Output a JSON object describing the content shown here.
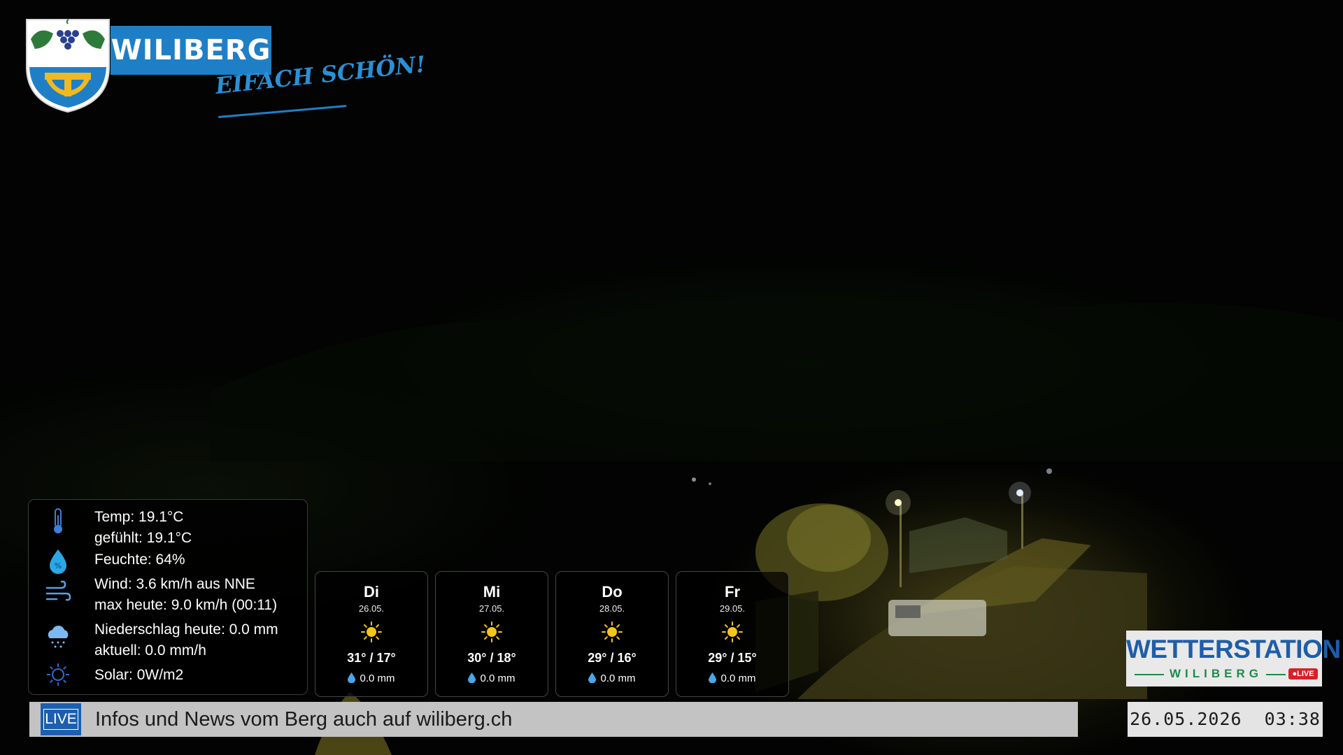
{
  "branding": {
    "name": "WILIBERG",
    "slogan": "EIFACH SCHÖN!",
    "brand_color": "#1f7fc6"
  },
  "current": {
    "temp": "Temp: 19.1°C",
    "feels": "gefühlt: 19.1°C",
    "humidity": "Feuchte: 64%",
    "wind": "Wind: 3.6 km/h aus NNE",
    "wind_max": "max heute: 9.0 km/h (00:11)",
    "precip_today": "Niederschlag heute: 0.0 mm",
    "precip_now": "aktuell: 0.0 mm/h",
    "solar": "Solar: 0W/m2",
    "icons": [
      "thermometer-icon",
      "humidity-drop-icon",
      "wind-icon",
      "rain-cloud-icon",
      "sun-outline-icon"
    ]
  },
  "forecast": [
    {
      "day": "Di",
      "date": "26.05.",
      "temp": "31° / 17°",
      "rain": "0.0 mm",
      "icon": "sun-icon"
    },
    {
      "day": "Mi",
      "date": "27.05.",
      "temp": "30° / 18°",
      "rain": "0.0 mm",
      "icon": "sun-icon"
    },
    {
      "day": "Do",
      "date": "28.05.",
      "temp": "29° / 16°",
      "rain": "0.0 mm",
      "icon": "sun-icon"
    },
    {
      "day": "Fr",
      "date": "29.05.",
      "temp": "29° / 15°",
      "rain": "0.0 mm",
      "icon": "sun-icon"
    }
  ],
  "ticker": {
    "badge": "LIVE",
    "text": "Infos und News vom Berg auch auf wiliberg.ch"
  },
  "station": {
    "title": "WETTERSTATION",
    "subtitle": "WILIBERG",
    "live": "●LIVE"
  },
  "datetime": "26.05.2026  03:38",
  "colors": {
    "accent_blue": "#1f5da8",
    "accent_green": "#1f8a4c",
    "live_red": "#d92027",
    "sun_yellow": "#f5c518"
  }
}
